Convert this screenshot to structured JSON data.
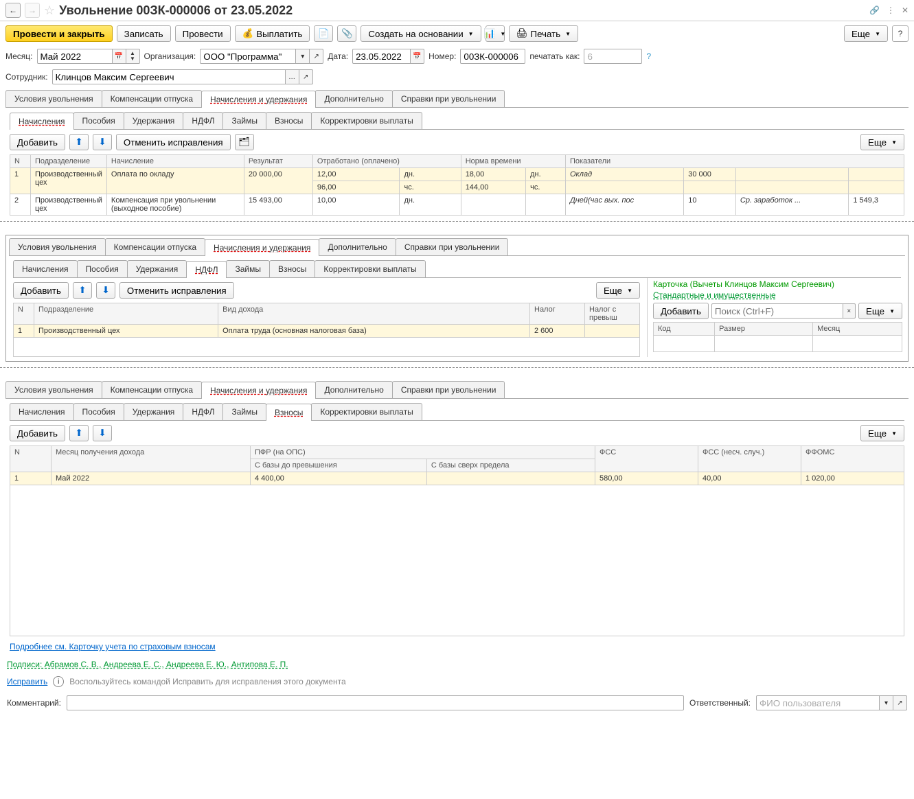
{
  "header": {
    "title": "Увольнение 00ЗК-000006 от 23.05.2022"
  },
  "toolbar": {
    "post_close": "Провести и закрыть",
    "save": "Записать",
    "post": "Провести",
    "pay": "Выплатить",
    "create_based": "Создать на основании",
    "print": "Печать",
    "more": "Еще"
  },
  "form": {
    "month_label": "Месяц:",
    "month_value": "Май 2022",
    "org_label": "Организация:",
    "org_value": "ООО \"Программа\"",
    "date_label": "Дата:",
    "date_value": "23.05.2022",
    "number_label": "Номер:",
    "number_value": "00ЗК-000006",
    "print_as_label": "печатать как:",
    "print_as_value": "6",
    "employee_label": "Сотрудник:",
    "employee_value": "Клинцов Максим Сергеевич"
  },
  "main_tabs": [
    "Условия увольнения",
    "Компенсации отпуска",
    "Начисления и удержания",
    "Дополнительно",
    "Справки при увольнении"
  ],
  "sub_tabs": [
    "Начисления",
    "Пособия",
    "Удержания",
    "НДФЛ",
    "Займы",
    "Взносы",
    "Корректировки выплаты"
  ],
  "panel": {
    "add": "Добавить",
    "undo_fix": "Отменить исправления",
    "more": "Еще"
  },
  "accruals": {
    "headers": {
      "n": "N",
      "dept": "Подразделение",
      "accrual": "Начисление",
      "result": "Результат",
      "worked": "Отработано (оплачено)",
      "norm": "Норма времени",
      "indicators": "Показатели"
    },
    "rows": [
      {
        "n": "1",
        "dept": "Производственный цех",
        "accrual": "Оплата по окладу",
        "result": "20 000,00",
        "worked_d": "12,00",
        "worked_du": "дн.",
        "worked_h": "96,00",
        "worked_hu": "чс.",
        "norm_d": "18,00",
        "norm_du": "дн.",
        "norm_h": "144,00",
        "norm_hu": "чс.",
        "ind_name": "Оклад",
        "ind_val": "30 000"
      },
      {
        "n": "2",
        "dept": "Производственный цех",
        "accrual": "Компенсация при увольнении (выходное пособие)",
        "result": "15 493,00",
        "worked_d": "10,00",
        "worked_du": "дн.",
        "ind_name": "Дней(час вых. пос",
        "ind_val": "10",
        "ind2_name": "Ср. заработок ...",
        "ind2_val": "1 549,3"
      }
    ]
  },
  "ndfl": {
    "headers": {
      "n": "N",
      "dept": "Подразделение",
      "income_type": "Вид дохода",
      "tax": "Налог",
      "tax_excess": "Налог с превыш"
    },
    "row": {
      "n": "1",
      "dept": "Производственный цех",
      "income_type": "Оплата труда (основная налоговая база)",
      "tax": "2 600"
    },
    "card_title": "Карточка (Вычеты Клинцов Максим Сергеевич)",
    "std_link": "Стандартные и имущественные",
    "add": "Добавить",
    "search_ph": "Поиск (Ctrl+F)",
    "more": "Еще",
    "cols": {
      "code": "Код",
      "size": "Размер",
      "month": "Месяц"
    }
  },
  "contributions": {
    "headers": {
      "n": "N",
      "month": "Месяц получения дохода",
      "pfr": "ПФР (на ОПС)",
      "pfr_under": "С базы до превышения",
      "pfr_over": "С базы сверх предела",
      "fss": "ФСС",
      "fss_acc": "ФСС (несч. случ.)",
      "ffoms": "ФФОМС"
    },
    "row": {
      "n": "1",
      "month": "Май 2022",
      "pfr_under": "4 400,00",
      "fss": "580,00",
      "fss_acc": "40,00",
      "ffoms": "1 020,00"
    },
    "details_link": "Подробнее см. Карточку учета по страховым взносам"
  },
  "footer": {
    "signatures": "Подписи: Абрамов С. В., Андреева Е. С., Андреева Е. Ю., Антипова Е. П.",
    "fix": "Исправить",
    "fix_hint": "Воспользуйтесь командой Исправить для исправления этого документа",
    "comment_label": "Комментарий:",
    "responsible_label": "Ответственный:",
    "responsible_value": "ФИО пользователя"
  }
}
